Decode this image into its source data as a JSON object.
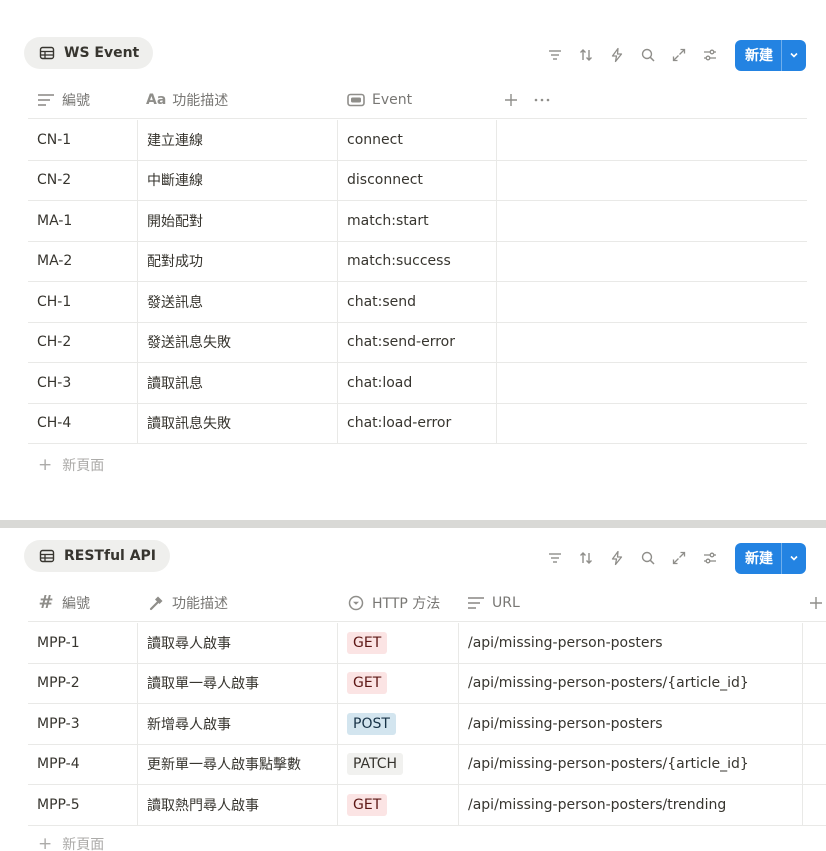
{
  "colors": {
    "accent": "#2383e2",
    "tag_get": "#fbe4e4",
    "tag_post": "#d3e5ef",
    "tag_patch": "#f1f1ef"
  },
  "ws": {
    "title": "WS Event",
    "new_label": "新建",
    "columns": [
      "編號",
      "功能描述",
      "Event"
    ],
    "rows": [
      [
        "CN-1",
        "建立連線",
        "connect"
      ],
      [
        "CN-2",
        "中斷連線",
        "disconnect"
      ],
      [
        "MA-1",
        "開始配對",
        "match:start"
      ],
      [
        "MA-2",
        "配對成功",
        "match:success"
      ],
      [
        "CH-1",
        "發送訊息",
        "chat:send"
      ],
      [
        "CH-2",
        "發送訊息失敗",
        "chat:send-error"
      ],
      [
        "CH-3",
        "讀取訊息",
        "chat:load"
      ],
      [
        "CH-4",
        "讀取訊息失敗",
        "chat:load-error"
      ]
    ],
    "new_page": "新頁面"
  },
  "rest": {
    "title": "RESTful API",
    "new_label": "新建",
    "columns": [
      "編號",
      "功能描述",
      "HTTP 方法",
      "URL"
    ],
    "rows": [
      [
        "MPP-1",
        "讀取尋人啟事",
        "GET",
        "/api/missing-person-posters"
      ],
      [
        "MPP-2",
        "讀取單一尋人啟事",
        "GET",
        "/api/missing-person-posters/{article_id}"
      ],
      [
        "MPP-3",
        "新增尋人啟事",
        "POST",
        "/api/missing-person-posters"
      ],
      [
        "MPP-4",
        "更新單一尋人啟事點擊數",
        "PATCH",
        "/api/missing-person-posters/{article_id}"
      ],
      [
        "MPP-5",
        "讀取熱門尋人啟事",
        "GET",
        "/api/missing-person-posters/trending"
      ]
    ],
    "new_page": "新頁面"
  }
}
